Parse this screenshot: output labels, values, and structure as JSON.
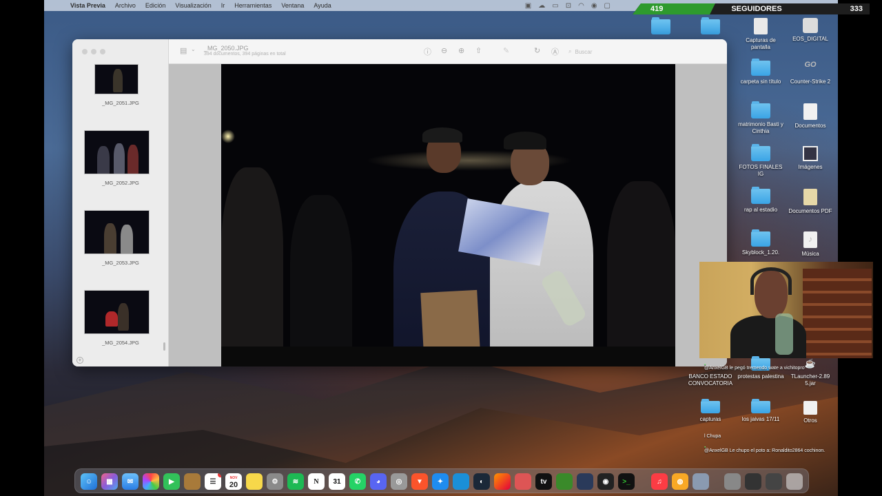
{
  "menubar": {
    "app": "Vista Previa",
    "items": [
      "Archivo",
      "Edición",
      "Visualización",
      "Ir",
      "Herramientas",
      "Ventana",
      "Ayuda"
    ]
  },
  "followers": {
    "current": "419",
    "label": "SEGUIDORES",
    "goal": "333"
  },
  "preview": {
    "title": "_MG_2050.JPG",
    "subtitle": "394 documentos, 394 páginas en total",
    "search_placeholder": "Buscar",
    "thumbnails": [
      {
        "label": "_MG_2051.JPG"
      },
      {
        "label": "_MG_2052.JPG"
      },
      {
        "label": "_MG_2053.JPG"
      },
      {
        "label": "_MG_2054.JPG"
      }
    ]
  },
  "desktop": {
    "partial_label": "ra",
    "icons_col1": [
      {
        "label": "Capturas de pantalla"
      },
      {
        "label": "carpeta sin título"
      },
      {
        "label": "matrimonio Basti y Cinthia"
      },
      {
        "label": "FOTOS FINALES IG"
      },
      {
        "label": "rap al estadio"
      },
      {
        "label": "Skyblock_1.20."
      }
    ],
    "icons_col2": [
      {
        "label": "EOS_DIGITAL"
      },
      {
        "label": "Counter-Strike 2"
      },
      {
        "label": "Documentos"
      },
      {
        "label": "Imágenes"
      },
      {
        "label": "Documentos PDF"
      },
      {
        "label": "Música"
      }
    ],
    "icons_lower": [
      {
        "label": "BANCO ESTADO CONVOCATORIA"
      },
      {
        "label": "protestas palestina"
      },
      {
        "label": "TLauncher-2.89 5.jar"
      },
      {
        "label": "capturas"
      },
      {
        "label": "los jaivas 17/11"
      },
      {
        "label": "Otros"
      }
    ]
  },
  "chat": [
    {
      "text": "@AnxelGB le pegó tremendo wate a vichitopro"
    },
    {
      "text": "l Chupa"
    },
    {
      "text": "@AnxelGB Le chupo el poto a: Ronaldito2864 cochinon."
    }
  ],
  "dock": {
    "calendar_day": "20",
    "calendar_month": "NOV",
    "notion_letter": "N",
    "date_icon": "31"
  }
}
